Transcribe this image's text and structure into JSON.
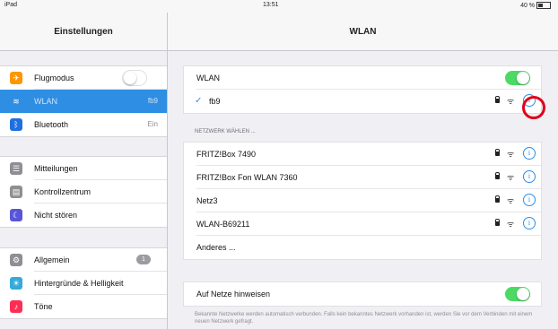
{
  "status_bar": {
    "device": "iPad",
    "time": "13:51",
    "battery": "40 %"
  },
  "left": {
    "title": "Einstellungen",
    "group1": [
      {
        "label": "Flugmodus",
        "icon": "airplane-icon",
        "color": "#ff9500",
        "value": ""
      },
      {
        "label": "WLAN",
        "icon": "wifi-icon",
        "color": "#2e8ee4",
        "value": "fb9"
      },
      {
        "label": "Bluetooth",
        "icon": "bluetooth-icon",
        "color": "#1f6fe0",
        "value": "Ein"
      }
    ],
    "group2": [
      {
        "label": "Mitteilungen",
        "icon": "notifications-icon",
        "color": "#8e8e93"
      },
      {
        "label": "Kontrollzentrum",
        "icon": "control-center-icon",
        "color": "#8e8e93"
      },
      {
        "label": "Nicht stören",
        "icon": "moon-icon",
        "color": "#5856d6"
      }
    ],
    "group3": [
      {
        "label": "Allgemein",
        "icon": "gear-icon",
        "color": "#8e8e93",
        "badge": "1"
      },
      {
        "label": "Hintergründe & Helligkeit",
        "icon": "brightness-icon",
        "color": "#34aadc"
      },
      {
        "label": "Töne",
        "icon": "speaker-icon",
        "color": "#ff2d55"
      }
    ]
  },
  "right": {
    "title": "WLAN",
    "wlan_label": "WLAN",
    "connected_network": "fb9",
    "section_header": "NETZWERK WÄHLEN ...",
    "networks": [
      {
        "name": "FRITZ!Box 7490",
        "locked": true
      },
      {
        "name": "FRITZ!Box Fon WLAN 7360",
        "locked": true
      },
      {
        "name": "Netz3",
        "locked": true
      },
      {
        "name": "WLAN-B69211",
        "locked": true
      }
    ],
    "other_label": "Anderes ...",
    "ask_label": "Auf Netze hinweisen",
    "footer": "Bekannte Netzwerke werden automatisch verbunden. Falls kein bekanntes Netzwerk vorhanden ist, werden Sie vor dem Verbinden mit einem neuen Netzwerk gefragt.",
    "accent": "#2e8ee4",
    "toggle_on_color": "#4cd964",
    "highlight_color": "#e0001a"
  }
}
